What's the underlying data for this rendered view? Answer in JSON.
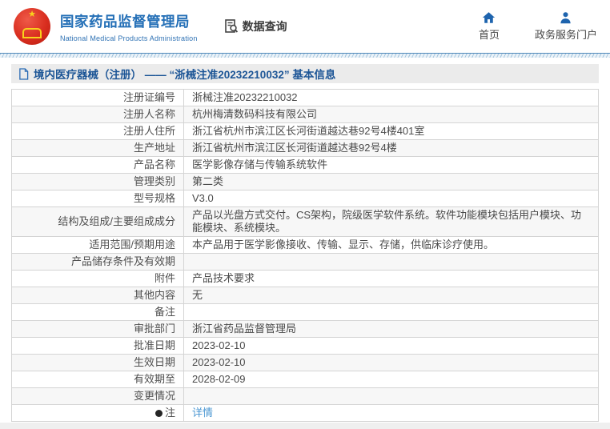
{
  "header": {
    "title": "国家药品监督管理局",
    "subtitle": "National Medical Products Administration",
    "data_query_label": "数据查询",
    "nav": [
      {
        "label": "首页",
        "icon": "home-icon"
      },
      {
        "label": "政务服务门户",
        "icon": "person-icon"
      }
    ]
  },
  "breadcrumb": {
    "text": "境内医疗器械（注册） —— “浙械注准20232210032” 基本信息"
  },
  "table": {
    "rows": [
      {
        "label": "注册证编号",
        "value": "浙械注准20232210032"
      },
      {
        "label": "注册人名称",
        "value": "杭州梅清数码科技有限公司"
      },
      {
        "label": "注册人住所",
        "value": "浙江省杭州市滨江区长河街道越达巷92号4楼401室"
      },
      {
        "label": "生产地址",
        "value": "浙江省杭州市滨江区长河街道越达巷92号4楼"
      },
      {
        "label": "产品名称",
        "value": "医学影像存储与传输系统软件"
      },
      {
        "label": "管理类别",
        "value": "第二类"
      },
      {
        "label": "型号规格",
        "value": "V3.0"
      },
      {
        "label": "结构及组成/主要组成成分",
        "value": "产品以光盘方式交付。CS架构，院级医学软件系统。软件功能模块包括用户模块、功能模块、系统模块。"
      },
      {
        "label": "适用范围/预期用途",
        "value": "本产品用于医学影像接收、传输、显示、存储，供临床诊疗使用。"
      },
      {
        "label": "产品储存条件及有效期",
        "value": ""
      },
      {
        "label": "附件",
        "value": "产品技术要求"
      },
      {
        "label": "其他内容",
        "value": "无"
      },
      {
        "label": "备注",
        "value": ""
      },
      {
        "label": "审批部门",
        "value": "浙江省药品监督管理局"
      },
      {
        "label": "批准日期",
        "value": "2023-02-10"
      },
      {
        "label": "生效日期",
        "value": "2023-02-10"
      },
      {
        "label": "有效期至",
        "value": "2028-02-09"
      },
      {
        "label": "变更情况",
        "value": ""
      },
      {
        "label": "注",
        "value": "详情",
        "link": true,
        "icon": "note-icon"
      }
    ]
  },
  "colors": {
    "accent_blue": "#2570b7",
    "icon_blue": "#1e64ae",
    "breadcrumb_blue": "#1c5596",
    "link_blue": "#4b97d2",
    "emblem_red": "#d92e1f",
    "emblem_gold": "#f8d21c",
    "row_alt_gray": "#f7f7f7",
    "bar_gray": "#ebebeb",
    "border_gray": "#d4d4d4"
  }
}
